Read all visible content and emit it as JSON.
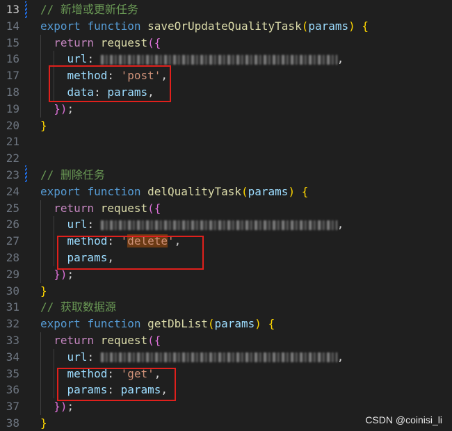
{
  "lines": [
    {
      "n": "13",
      "parts": [
        [
          "cm",
          "// 新增或更新任务"
        ]
      ]
    },
    {
      "n": "14",
      "parts": [
        [
          "kw",
          "export"
        ],
        [
          "punc",
          " "
        ],
        [
          "kw",
          "function"
        ],
        [
          "punc",
          " "
        ],
        [
          "fn",
          "saveOrUpdateQualityTask"
        ],
        [
          "br1",
          "("
        ],
        [
          "var",
          "params"
        ],
        [
          "br1",
          ")"
        ],
        [
          "punc",
          " "
        ],
        [
          "br1",
          "{"
        ]
      ]
    },
    {
      "n": "15",
      "parts": [
        [
          "punc",
          "  "
        ],
        [
          "kw2",
          "return"
        ],
        [
          "punc",
          " "
        ],
        [
          "fn",
          "request"
        ],
        [
          "br2",
          "({"
        ]
      ]
    },
    {
      "n": "16",
      "parts": [
        [
          "punc",
          "    "
        ],
        [
          "var",
          "url"
        ],
        [
          "punc",
          ": "
        ],
        [
          "blur",
          ""
        ],
        [
          "punc",
          ","
        ]
      ]
    },
    {
      "n": "17",
      "parts": [
        [
          "punc",
          "    "
        ],
        [
          "var",
          "method"
        ],
        [
          "punc",
          ": "
        ],
        [
          "str",
          "'post'"
        ],
        [
          "punc",
          ","
        ]
      ]
    },
    {
      "n": "18",
      "parts": [
        [
          "punc",
          "    "
        ],
        [
          "var",
          "data"
        ],
        [
          "punc",
          ": "
        ],
        [
          "var",
          "params"
        ],
        [
          "punc",
          ","
        ]
      ]
    },
    {
      "n": "19",
      "parts": [
        [
          "punc",
          "  "
        ],
        [
          "br2",
          "})"
        ],
        [
          "punc",
          ";"
        ]
      ]
    },
    {
      "n": "20",
      "parts": [
        [
          "br1",
          "}"
        ]
      ]
    },
    {
      "n": "21",
      "parts": []
    },
    {
      "n": "22",
      "parts": []
    },
    {
      "n": "23",
      "parts": [
        [
          "cm",
          "// 删除任务"
        ]
      ]
    },
    {
      "n": "24",
      "parts": [
        [
          "kw",
          "export"
        ],
        [
          "punc",
          " "
        ],
        [
          "kw",
          "function"
        ],
        [
          "punc",
          " "
        ],
        [
          "fn",
          "delQualityTask"
        ],
        [
          "br1",
          "("
        ],
        [
          "var",
          "params"
        ],
        [
          "br1",
          ")"
        ],
        [
          "punc",
          " "
        ],
        [
          "br1",
          "{"
        ]
      ]
    },
    {
      "n": "25",
      "parts": [
        [
          "punc",
          "  "
        ],
        [
          "kw2",
          "return"
        ],
        [
          "punc",
          " "
        ],
        [
          "fn",
          "request"
        ],
        [
          "br2",
          "({"
        ]
      ]
    },
    {
      "n": "26",
      "parts": [
        [
          "punc",
          "    "
        ],
        [
          "var",
          "url"
        ],
        [
          "punc",
          ": "
        ],
        [
          "blur",
          ""
        ],
        [
          "punc",
          ","
        ]
      ]
    },
    {
      "n": "27",
      "parts": [
        [
          "punc",
          "    "
        ],
        [
          "var",
          "method"
        ],
        [
          "punc",
          ": "
        ],
        [
          "str",
          "'"
        ],
        [
          "strsel",
          "delete"
        ],
        [
          "str",
          "'"
        ],
        [
          "punc",
          ","
        ]
      ]
    },
    {
      "n": "28",
      "parts": [
        [
          "punc",
          "    "
        ],
        [
          "var",
          "params"
        ],
        [
          "punc",
          ","
        ]
      ]
    },
    {
      "n": "29",
      "parts": [
        [
          "punc",
          "  "
        ],
        [
          "br2",
          "})"
        ],
        [
          "punc",
          ";"
        ]
      ]
    },
    {
      "n": "30",
      "parts": [
        [
          "br1",
          "}"
        ]
      ]
    },
    {
      "n": "31",
      "parts": [
        [
          "cm",
          "// 获取数据源"
        ]
      ]
    },
    {
      "n": "32",
      "parts": [
        [
          "kw",
          "export"
        ],
        [
          "punc",
          " "
        ],
        [
          "kw",
          "function"
        ],
        [
          "punc",
          " "
        ],
        [
          "fn",
          "getDbList"
        ],
        [
          "br1",
          "("
        ],
        [
          "var",
          "params"
        ],
        [
          "br1",
          ")"
        ],
        [
          "punc",
          " "
        ],
        [
          "br1",
          "{"
        ]
      ]
    },
    {
      "n": "33",
      "parts": [
        [
          "punc",
          "  "
        ],
        [
          "kw2",
          "return"
        ],
        [
          "punc",
          " "
        ],
        [
          "fn",
          "request"
        ],
        [
          "br2",
          "({"
        ]
      ]
    },
    {
      "n": "34",
      "parts": [
        [
          "punc",
          "    "
        ],
        [
          "var",
          "url"
        ],
        [
          "punc",
          ": "
        ],
        [
          "blur",
          ""
        ],
        [
          "punc",
          ","
        ]
      ]
    },
    {
      "n": "35",
      "parts": [
        [
          "punc",
          "    "
        ],
        [
          "var",
          "method"
        ],
        [
          "punc",
          ": "
        ],
        [
          "str",
          "'get'"
        ],
        [
          "punc",
          ","
        ]
      ]
    },
    {
      "n": "36",
      "parts": [
        [
          "punc",
          "    "
        ],
        [
          "var",
          "params"
        ],
        [
          "punc",
          ": "
        ],
        [
          "var",
          "params"
        ],
        [
          "punc",
          ","
        ]
      ]
    },
    {
      "n": "37",
      "parts": [
        [
          "punc",
          "  "
        ],
        [
          "br2",
          "})"
        ],
        [
          "punc",
          ";"
        ]
      ]
    },
    {
      "n": "38",
      "parts": [
        [
          "br1",
          "}"
        ]
      ]
    }
  ],
  "active_line": "13",
  "watermark": "CSDN @coinisi_li",
  "colors": {
    "background": "#1f1f1f",
    "highlight_box": "#e0201c",
    "keyword": "#569cd6",
    "control_keyword": "#c586c0",
    "function": "#dcdcaa",
    "variable": "#9cdcfe",
    "string": "#ce9178",
    "comment": "#6a9955"
  }
}
